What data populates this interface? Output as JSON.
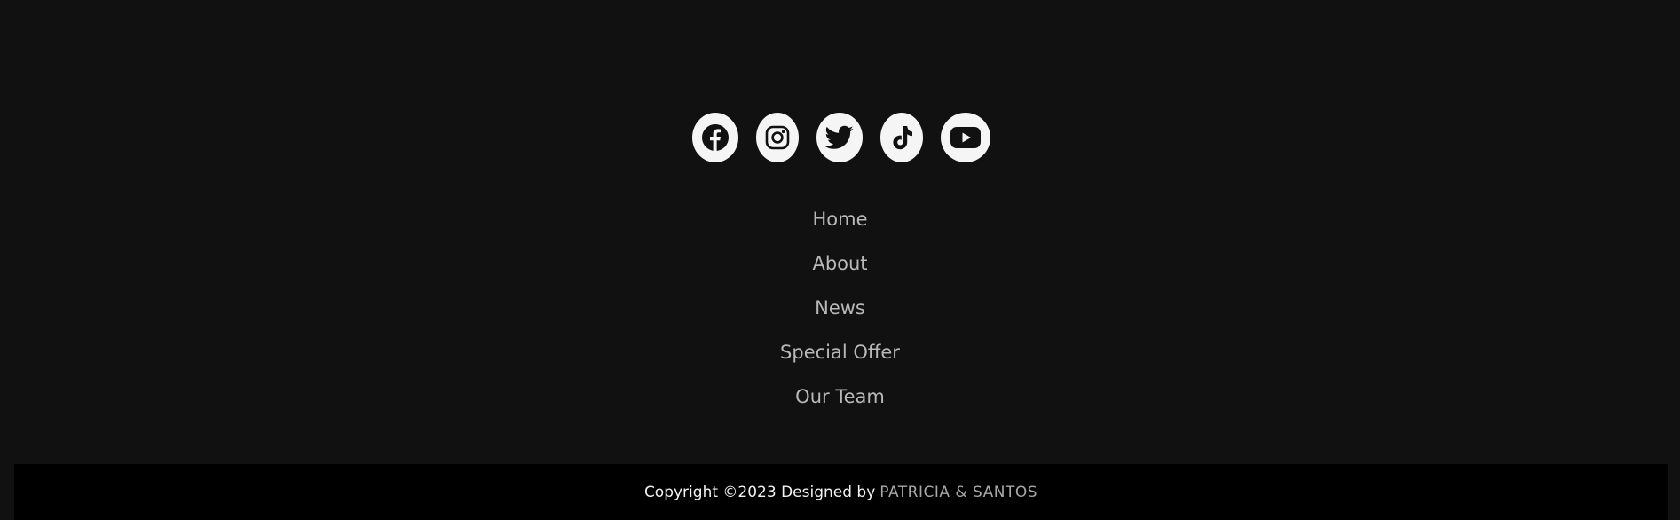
{
  "colors": {
    "page_background": "#111111",
    "bottom_bar_background": "#000000",
    "icon_background": "#f5f5f5",
    "icon_glyph": "#111111",
    "nav_text": "#b8b8b8",
    "copyright_text": "#f2f2f2",
    "designer_text": "#a8a8a8"
  },
  "social": [
    {
      "icon": "facebook-icon"
    },
    {
      "icon": "instagram-icon"
    },
    {
      "icon": "twitter-icon"
    },
    {
      "icon": "tiktok-icon"
    },
    {
      "icon": "youtube-icon"
    }
  ],
  "nav": {
    "items": [
      {
        "label": "Home"
      },
      {
        "label": "About"
      },
      {
        "label": "News"
      },
      {
        "label": "Special Offer"
      },
      {
        "label": "Our Team"
      }
    ]
  },
  "footer": {
    "copyright": "Copyright ©2023 Designed by",
    "designer": "PATRICIA & SANTOS"
  }
}
